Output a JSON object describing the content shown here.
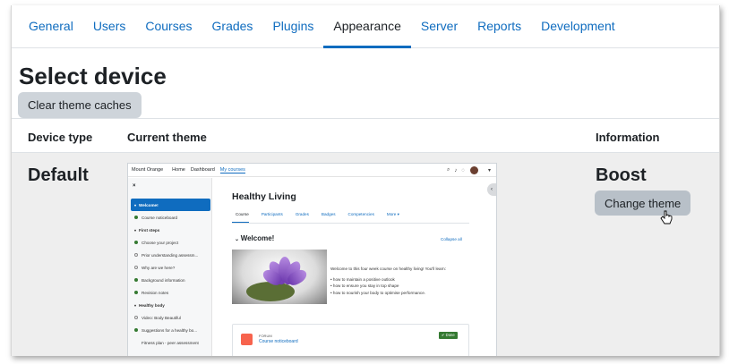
{
  "tabs": [
    "General",
    "Users",
    "Courses",
    "Grades",
    "Plugins",
    "Appearance",
    "Server",
    "Reports",
    "Development"
  ],
  "active_tab": "Appearance",
  "page_title": "Select device",
  "clear_button": "Clear theme caches",
  "table": {
    "headers": [
      "Device type",
      "Current theme",
      "Information"
    ],
    "row": {
      "device": "Default",
      "theme_name": "Boost",
      "change_button": "Change theme"
    }
  },
  "preview": {
    "site_name": "Mount Orange",
    "nav": [
      "Home",
      "Dashboard",
      "My courses"
    ],
    "nav_current": "My courses",
    "close": "×",
    "sidebar": [
      {
        "label": "Welcome!",
        "kind": "selected"
      },
      {
        "label": "Course noticeboard",
        "kind": "done"
      },
      {
        "label": "First steps",
        "kind": "section"
      },
      {
        "label": "Choose your project",
        "kind": "done"
      },
      {
        "label": "Prior understanding assessm...",
        "kind": "open"
      },
      {
        "label": "Why are we here?",
        "kind": "open"
      },
      {
        "label": "Background information",
        "kind": "done"
      },
      {
        "label": "Revision notes",
        "kind": "done"
      },
      {
        "label": "Healthy body",
        "kind": "section"
      },
      {
        "label": "Video: Body Beautiful",
        "kind": "open"
      },
      {
        "label": "Suggestions for a healthy bo...",
        "kind": "done"
      },
      {
        "label": "Fitness plan - peer assessment",
        "kind": "plain"
      }
    ],
    "course_title": "Healthy Living",
    "course_tabs": [
      "Course",
      "Participants",
      "Grades",
      "Badges",
      "Competencies",
      "More ▾"
    ],
    "course_tab_active": "Course",
    "section_title": "Welcome!",
    "collapse_all": "Collapse all",
    "intro": "Welcome to this four week course on healthy living! You'll learn:",
    "bullets": [
      "how to maintain a positive outlook",
      "how to ensure you stay in top shape",
      "how to nourish your body to optimise performance."
    ],
    "activity": {
      "type": "FORUM",
      "name": "Course noticeboard",
      "status": "✔ Done"
    }
  },
  "colors": {
    "brand_blue": "#0f6cbf",
    "button_grey": "#ced4da",
    "row_bg": "#eeeeee",
    "done_green": "#357a32"
  }
}
